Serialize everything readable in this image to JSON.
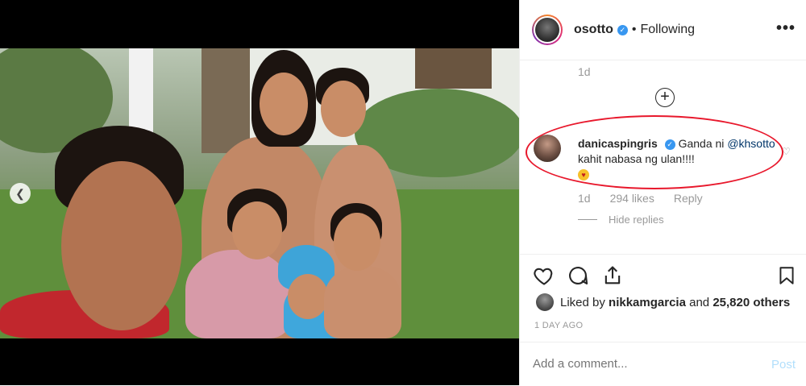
{
  "header": {
    "username": "osotto",
    "separator": "•",
    "follow_label": "Following",
    "more_label": "•••"
  },
  "comments": {
    "time_top": "1d",
    "load_more_label": "+",
    "comment": {
      "username": "danicaspingris",
      "text_before": "Ganda ni",
      "mention": "@khsotto",
      "text_after": "kahit nabasa ng ulan!!!!",
      "emoji": "heart-eyes-emoji",
      "time": "1d",
      "likes": "294 likes",
      "reply_label": "Reply",
      "hide_replies_label": "Hide replies"
    }
  },
  "likes": {
    "prefix": "Liked by",
    "user": "nikkamgarcia",
    "middle": "and",
    "others": "25,820 others"
  },
  "date": "1 DAY AGO",
  "add_comment": {
    "placeholder": "Add a comment...",
    "post_label": "Post"
  },
  "colors": {
    "verified": "#3897f0",
    "highlight_ellipse": "#e8182c",
    "post_disabled": "#b2dffc",
    "mention": "#003569"
  },
  "icons": [
    "chevron-left-icon",
    "more-icon",
    "add-circle-icon",
    "heart-icon",
    "comment-icon",
    "share-icon",
    "bookmark-icon",
    "verified-icon"
  ]
}
